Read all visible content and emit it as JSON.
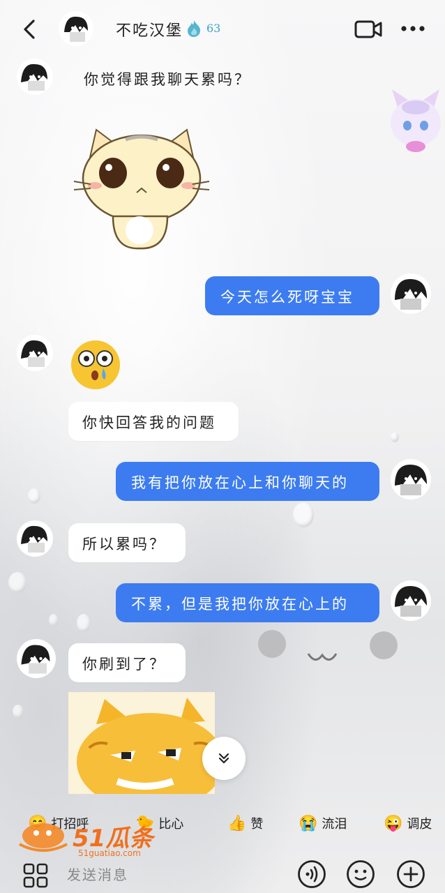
{
  "header": {
    "contact_name": "不吃汉堡",
    "streak_count": "63"
  },
  "messages": [
    {
      "side": "in",
      "text": "你觉得跟我聊天累吗？"
    },
    {
      "side": "in",
      "sticker": "sad-cat-sticker"
    },
    {
      "side": "out",
      "text": "今天怎么死呀宝宝"
    },
    {
      "side": "in",
      "sticker": "surprised-emoji"
    },
    {
      "side": "in",
      "text": "你快回答我的问题"
    },
    {
      "side": "out",
      "text": "我有把你放在心上和你聊天的"
    },
    {
      "side": "in",
      "text": "所以累吗？"
    },
    {
      "side": "out",
      "text": "不累，但是我把你放在心上的"
    },
    {
      "side": "in",
      "text": "你刷到了？"
    },
    {
      "side": "in",
      "sticker": "orange-cat-sticker"
    }
  ],
  "quick_replies": [
    {
      "icon": "😊",
      "label": "打招呼"
    },
    {
      "icon": "🐤",
      "label": "比心"
    },
    {
      "icon": "👍",
      "label": "赞"
    },
    {
      "icon": "😭",
      "label": "流泪"
    },
    {
      "icon": "😜",
      "label": "调皮"
    }
  ],
  "input": {
    "placeholder": "发送消息"
  },
  "watermark": {
    "brand": "51瓜条",
    "url": "51guatiao.com"
  },
  "colors": {
    "accent": "#3d7cf0",
    "streak": "#3aa6c4"
  }
}
